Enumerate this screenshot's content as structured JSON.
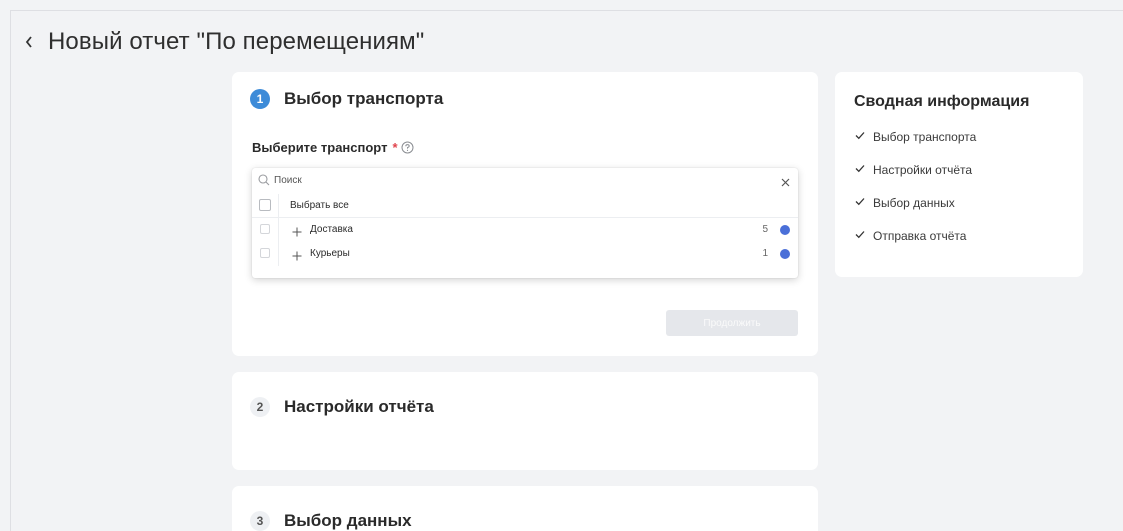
{
  "header": {
    "title": "Новый отчет \"По перемещениям\""
  },
  "steps": [
    {
      "number": "1",
      "title": "Выбор транспорта"
    },
    {
      "number": "2",
      "title": "Настройки отчёта"
    },
    {
      "number": "3",
      "title": "Выбор данных"
    }
  ],
  "transport": {
    "label": "Выберите транспорт",
    "required_mark": "*",
    "search_placeholder": "Поиск",
    "select_all": "Выбрать все",
    "groups": [
      {
        "name": "Доставка",
        "count": "5",
        "color": "#4a6fd8"
      },
      {
        "name": "Курьеры",
        "count": "1",
        "color": "#4a6fd8"
      }
    ],
    "continue_label": "Продолжить"
  },
  "summary": {
    "title": "Сводная информация",
    "items": [
      "Выбор транспорта",
      "Настройки отчёта",
      "Выбор данных",
      "Отправка отчёта"
    ]
  },
  "colors": {
    "accent": "#3d8bd8",
    "required": "#e0434c",
    "group_dot": "#4a6fd8"
  }
}
